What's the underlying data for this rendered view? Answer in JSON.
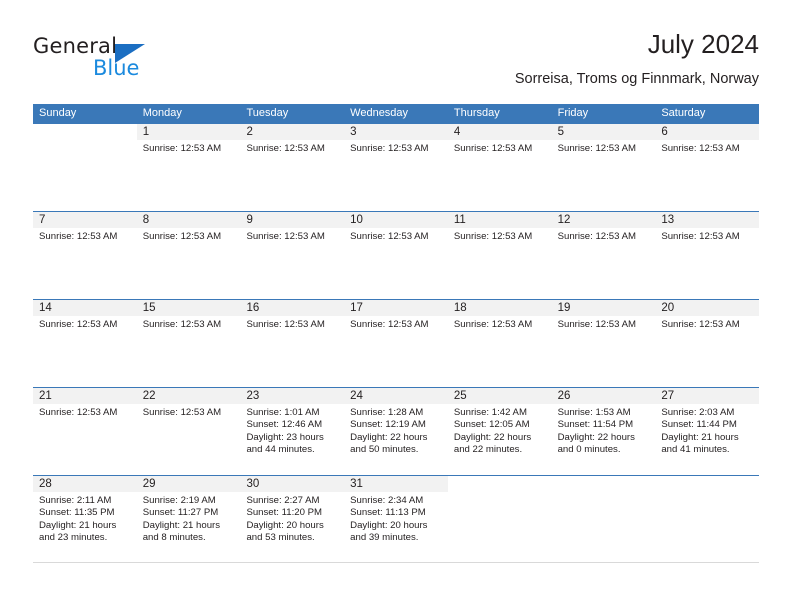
{
  "brand": {
    "name_top": "General",
    "name_bottom": "Blue",
    "accent_color": "#1b6ec2",
    "accent_color_light": "#1b8ade"
  },
  "header": {
    "title": "July 2024",
    "subtitle": "Sorreisa, Troms og Finnmark, Norway"
  },
  "calendar": {
    "header_bg": "#3a78b8",
    "daynum_band_bg": "#f2f2f2",
    "weekday_headers": [
      "Sunday",
      "Monday",
      "Tuesday",
      "Wednesday",
      "Thursday",
      "Friday",
      "Saturday"
    ],
    "weeks": [
      [
        {
          "day": "",
          "lines": []
        },
        {
          "day": "1",
          "lines": [
            "Sunrise: 12:53 AM"
          ]
        },
        {
          "day": "2",
          "lines": [
            "Sunrise: 12:53 AM"
          ]
        },
        {
          "day": "3",
          "lines": [
            "Sunrise: 12:53 AM"
          ]
        },
        {
          "day": "4",
          "lines": [
            "Sunrise: 12:53 AM"
          ]
        },
        {
          "day": "5",
          "lines": [
            "Sunrise: 12:53 AM"
          ]
        },
        {
          "day": "6",
          "lines": [
            "Sunrise: 12:53 AM"
          ]
        }
      ],
      [
        {
          "day": "7",
          "lines": [
            "Sunrise: 12:53 AM"
          ]
        },
        {
          "day": "8",
          "lines": [
            "Sunrise: 12:53 AM"
          ]
        },
        {
          "day": "9",
          "lines": [
            "Sunrise: 12:53 AM"
          ]
        },
        {
          "day": "10",
          "lines": [
            "Sunrise: 12:53 AM"
          ]
        },
        {
          "day": "11",
          "lines": [
            "Sunrise: 12:53 AM"
          ]
        },
        {
          "day": "12",
          "lines": [
            "Sunrise: 12:53 AM"
          ]
        },
        {
          "day": "13",
          "lines": [
            "Sunrise: 12:53 AM"
          ]
        }
      ],
      [
        {
          "day": "14",
          "lines": [
            "Sunrise: 12:53 AM"
          ]
        },
        {
          "day": "15",
          "lines": [
            "Sunrise: 12:53 AM"
          ]
        },
        {
          "day": "16",
          "lines": [
            "Sunrise: 12:53 AM"
          ]
        },
        {
          "day": "17",
          "lines": [
            "Sunrise: 12:53 AM"
          ]
        },
        {
          "day": "18",
          "lines": [
            "Sunrise: 12:53 AM"
          ]
        },
        {
          "day": "19",
          "lines": [
            "Sunrise: 12:53 AM"
          ]
        },
        {
          "day": "20",
          "lines": [
            "Sunrise: 12:53 AM"
          ]
        }
      ],
      [
        {
          "day": "21",
          "lines": [
            "Sunrise: 12:53 AM"
          ]
        },
        {
          "day": "22",
          "lines": [
            "Sunrise: 12:53 AM"
          ]
        },
        {
          "day": "23",
          "lines": [
            "Sunrise: 1:01 AM",
            "Sunset: 12:46 AM",
            "Daylight: 23 hours",
            "and 44 minutes."
          ]
        },
        {
          "day": "24",
          "lines": [
            "Sunrise: 1:28 AM",
            "Sunset: 12:19 AM",
            "Daylight: 22 hours",
            "and 50 minutes."
          ]
        },
        {
          "day": "25",
          "lines": [
            "Sunrise: 1:42 AM",
            "Sunset: 12:05 AM",
            "Daylight: 22 hours",
            "and 22 minutes."
          ]
        },
        {
          "day": "26",
          "lines": [
            "Sunrise: 1:53 AM",
            "Sunset: 11:54 PM",
            "Daylight: 22 hours",
            "and 0 minutes."
          ]
        },
        {
          "day": "27",
          "lines": [
            "Sunrise: 2:03 AM",
            "Sunset: 11:44 PM",
            "Daylight: 21 hours",
            "and 41 minutes."
          ]
        }
      ],
      [
        {
          "day": "28",
          "lines": [
            "Sunrise: 2:11 AM",
            "Sunset: 11:35 PM",
            "Daylight: 21 hours",
            "and 23 minutes."
          ]
        },
        {
          "day": "29",
          "lines": [
            "Sunrise: 2:19 AM",
            "Sunset: 11:27 PM",
            "Daylight: 21 hours",
            "and 8 minutes."
          ]
        },
        {
          "day": "30",
          "lines": [
            "Sunrise: 2:27 AM",
            "Sunset: 11:20 PM",
            "Daylight: 20 hours",
            "and 53 minutes."
          ]
        },
        {
          "day": "31",
          "lines": [
            "Sunrise: 2:34 AM",
            "Sunset: 11:13 PM",
            "Daylight: 20 hours",
            "and 39 minutes."
          ]
        },
        {
          "day": "",
          "lines": []
        },
        {
          "day": "",
          "lines": []
        },
        {
          "day": "",
          "lines": []
        }
      ]
    ]
  }
}
